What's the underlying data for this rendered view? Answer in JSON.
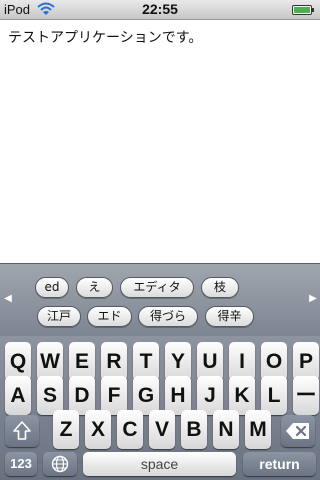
{
  "status_bar": {
    "carrier": "iPod",
    "time": "22:55"
  },
  "content": {
    "body_text": "テストアプリケーションです。"
  },
  "candidates": {
    "row1": [
      "ed",
      "え",
      "エディタ",
      "枝"
    ],
    "row2": [
      "江戸",
      "エド",
      "得づら",
      "得辛"
    ]
  },
  "keyboard": {
    "row1": [
      "Q",
      "W",
      "E",
      "R",
      "T",
      "Y",
      "U",
      "I",
      "O",
      "P"
    ],
    "row2": [
      "A",
      "S",
      "D",
      "F",
      "G",
      "H",
      "J",
      "K",
      "L",
      "ー"
    ],
    "row3": [
      "Z",
      "X",
      "C",
      "V",
      "B",
      "N",
      "M"
    ],
    "numbers_label": "123",
    "space_label": "space",
    "return_label": "return"
  }
}
